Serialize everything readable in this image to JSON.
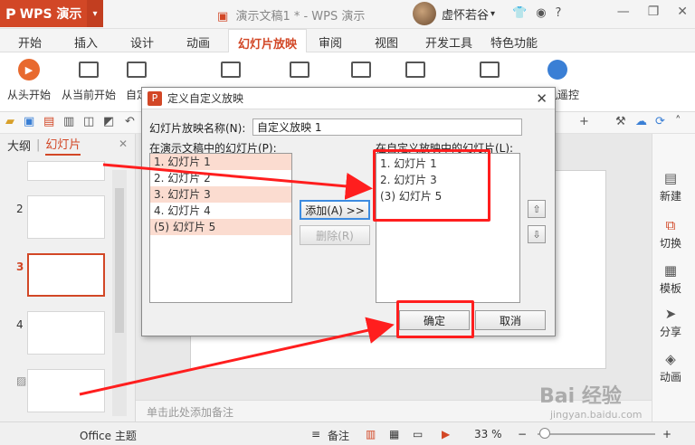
{
  "titlebar": {
    "app_name": "WPS 演示",
    "logo": "P",
    "doc_title": "演示文稿1 * - WPS 演示",
    "user_name": "虚怀若谷",
    "icons": [
      "user-switch-icon",
      "shirt-icon",
      "weibo-icon",
      "help-icon",
      "minimize-icon",
      "restore-icon",
      "close-icon"
    ],
    "help_glyph": "?",
    "min_glyph": "—",
    "restore_glyph": "❐",
    "close_glyph": "✕"
  },
  "menu": {
    "tabs": [
      "开始",
      "插入",
      "设计",
      "动画",
      "幻灯片放映",
      "审阅",
      "视图",
      "开发工具",
      "特色功能"
    ],
    "active_index": 4
  },
  "ribbon": {
    "buttons": [
      {
        "label": "从头开始",
        "icon": "play-circle-icon"
      },
      {
        "label": "从当前开始",
        "icon": "play-screen-icon"
      },
      {
        "label": "自定",
        "icon": "custom-show-icon"
      }
    ],
    "right_buttons": [
      {
        "label": "手机遥控",
        "icon": "remote-icon"
      }
    ]
  },
  "left_panel": {
    "tab_outline": "大纲",
    "tab_slides": "幻灯片",
    "separator": "|",
    "close": "✕",
    "thumbnails": [
      {
        "num": "",
        "selected": false
      },
      {
        "num": "2",
        "selected": false
      },
      {
        "num": "3",
        "selected": true
      },
      {
        "num": "4",
        "selected": false
      },
      {
        "num": "",
        "selected": false
      }
    ]
  },
  "notes_placeholder": "单击此处添加备注",
  "right_sidebar": {
    "items": [
      {
        "label": "新建",
        "icon": "new-slide-icon",
        "glyph": "▤"
      },
      {
        "label": "切换",
        "icon": "transition-icon",
        "glyph": "⧉"
      },
      {
        "label": "模板",
        "icon": "template-icon",
        "glyph": "▦"
      },
      {
        "label": "分享",
        "icon": "share-icon",
        "glyph": "➤"
      },
      {
        "label": "动画",
        "icon": "animation-icon",
        "glyph": "◈"
      }
    ]
  },
  "statusbar": {
    "theme": "Office 主题",
    "notes_label": "备注",
    "zoom": "33 %",
    "zoom_minus": "−",
    "zoom_plus": "+"
  },
  "dialog": {
    "title": "定义自定义放映",
    "name_label": "幻灯片放映名称(N):",
    "name_value": "自定义放映 1",
    "left_list_label": "在演示文稿中的幻灯片(P):",
    "right_list_label": "在自定义放映中的幻灯片(L):",
    "left_items": [
      {
        "text": "1. 幻灯片 1",
        "highlight": true
      },
      {
        "text": "2. 幻灯片 2",
        "highlight": false
      },
      {
        "text": "3. 幻灯片 3",
        "highlight": true
      },
      {
        "text": "4. 幻灯片 4",
        "highlight": false
      },
      {
        "text": "(5) 幻灯片 5",
        "highlight": true
      }
    ],
    "right_items": [
      "1. 幻灯片 1",
      "2. 幻灯片 3",
      "(3) 幻灯片 5"
    ],
    "add_button": "添加(A) >>",
    "remove_button": "删除(R)",
    "ok_button": "确定",
    "cancel_button": "取消",
    "up_glyph": "⇧",
    "down_glyph": "⇩",
    "close_glyph": "✕"
  },
  "watermark": {
    "text": "Bai 经验",
    "url": "jingyan.baidu.com"
  },
  "colors": {
    "accent": "#d24726",
    "annotation": "#ff1e1e",
    "highlight": "#fbdcd0"
  }
}
